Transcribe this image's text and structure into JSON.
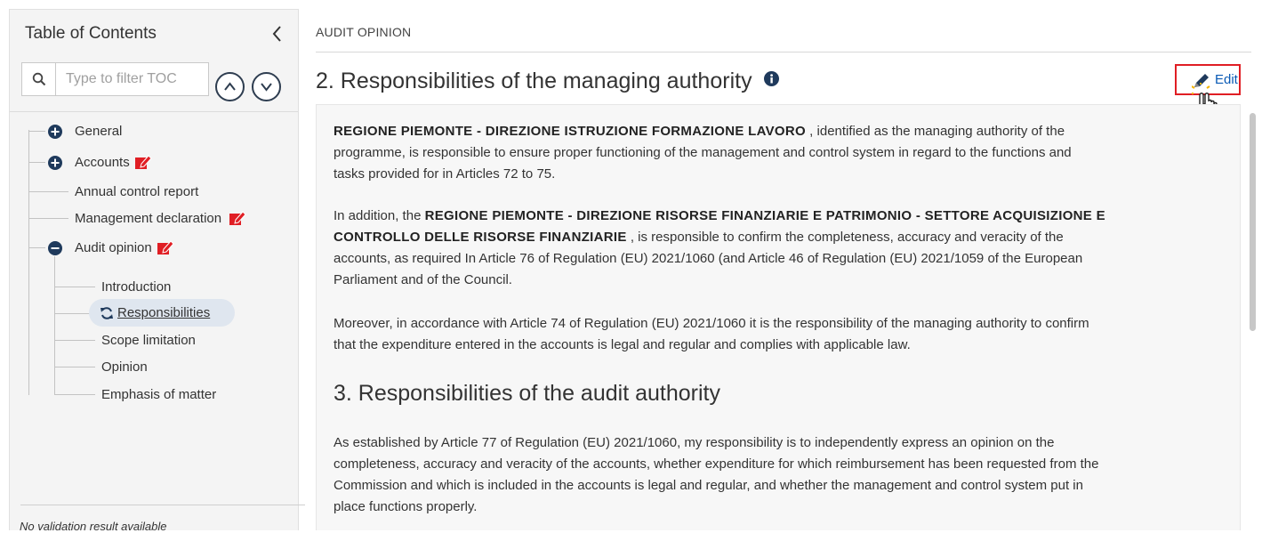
{
  "sidebar": {
    "title": "Table of Contents",
    "collapse_icon": "chevron-left-icon",
    "filter_placeholder": "Type to filter TOC",
    "items": [
      {
        "label": "General",
        "icon": "plus-circle-icon"
      },
      {
        "label": "Accounts",
        "icon": "plus-circle-icon",
        "edit_flag": "pencil-edit-icon"
      },
      {
        "label": "Annual control report"
      },
      {
        "label": "Management declaration",
        "edit_flag": "pencil-edit-icon"
      },
      {
        "label": "Audit opinion",
        "icon": "minus-circle-icon",
        "edit_flag": "pencil-edit-icon"
      },
      {
        "label": "Introduction"
      },
      {
        "label": "Responsibilities",
        "icon": "refresh-icon",
        "active": true
      },
      {
        "label": "Scope limitation"
      },
      {
        "label": "Opinion"
      },
      {
        "label": "Emphasis of matter"
      }
    ],
    "footer": "No validation result available"
  },
  "main": {
    "section_label": "AUDIT OPINION",
    "heading_2": "2. Responsibilities of the managing authority",
    "edit_label": "Edit",
    "p1_bold": "REGIONE PIEMONTE - DIREZIONE ISTRUZIONE FORMAZIONE LAVORO",
    "p1_line1_rest": " , identified as the managing authority of the",
    "p1_line2": "programme, is responsible to ensure proper functioning of the management and control system in regard to the functions and",
    "p1_line3": "tasks provided for in Articles 72 to 75.",
    "p2_prefix": "In addition, the ",
    "p2_bold_1": "REGIONE PIEMONTE - DIREZIONE RISORSE FINANZIARIE E PATRIMONIO - SETTORE ACQUISIZIONE E",
    "p2_bold_2": "CONTROLLO DELLE RISORSE FINANZIARIE",
    "p2_line2_rest": " , is responsible to confirm the completeness, accuracy and veracity of the",
    "p2_line3": "accounts, as required In Article 76 of Regulation (EU) 2021/1060 (and Article 46 of Regulation (EU) 2021/1059 of the European",
    "p2_line4": "Parliament and of the Council.",
    "p3_line1": "Moreover, in accordance with Article 74 of Regulation (EU) 2021/1060 it is the responsibility of the managing authority to confirm",
    "p3_line2": "that the expenditure entered in the accounts is legal and regular and complies with applicable law.",
    "heading_3": "3. Responsibilities of the audit authority",
    "p4_line1": "As established by Article 77 of Regulation (EU) 2021/1060, my responsibility is to independently express an opinion on the",
    "p4_line2": "completeness, accuracy and veracity of the accounts, whether expenditure for which reimbursement has been requested from the",
    "p4_line3": "Commission and which is included in the accounts is legal and regular, and whether the management and control system put in",
    "p4_line4": "place functions properly."
  },
  "colors": {
    "accent_blue": "#1f3a5c",
    "link_blue": "#0a5ab5",
    "edit_red": "#e01e24",
    "active_bg": "#dfe6ef"
  }
}
